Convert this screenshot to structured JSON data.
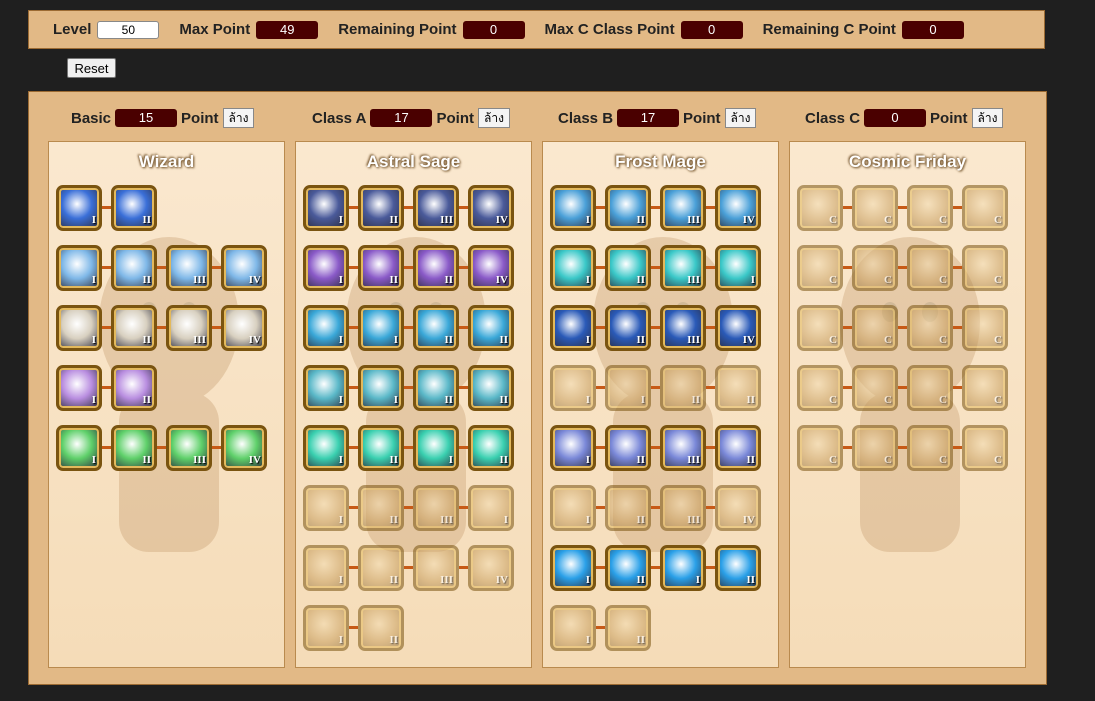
{
  "topbar": {
    "level_label": "Level",
    "level_value": "50",
    "max_point_label": "Max Point",
    "max_point_value": "49",
    "remaining_point_label": "Remaining Point",
    "remaining_point_value": "0",
    "max_c_label": "Max C Class Point",
    "max_c_value": "0",
    "remaining_c_label": "Remaining C Point",
    "remaining_c_value": "0"
  },
  "reset_label": "Reset",
  "point_word": "Point",
  "clear_label": "ล้าง",
  "columns": [
    {
      "key": "basic",
      "label": "Basic",
      "points": "15",
      "title": "Wizard",
      "rows": [
        [
          "I",
          "II"
        ],
        [
          "I",
          "II",
          "III",
          "IV"
        ],
        [
          "I",
          "II",
          "III",
          "IV"
        ],
        [
          "I",
          "II"
        ],
        [
          "I",
          "II",
          "III",
          "IV"
        ]
      ],
      "colors": [
        "#3a6fd8",
        "#7fb8e8",
        "#d8d0c0",
        "#b98ee0",
        "#5fd06a"
      ],
      "faded_rows": [
        false,
        false,
        false,
        false,
        false
      ]
    },
    {
      "key": "class_a",
      "label": "Class A",
      "points": "17",
      "title": "Astral Sage",
      "rows": [
        [
          "I",
          "II",
          "III",
          "IV"
        ],
        [
          "I",
          "II",
          "II",
          "IV"
        ],
        [
          "I",
          "I",
          "II",
          "II"
        ],
        [
          "I",
          "I",
          "II",
          "II"
        ],
        [
          "I",
          "II",
          "I",
          "II"
        ],
        [
          "I",
          "II",
          "III",
          "I"
        ],
        [
          "I",
          "II",
          "III",
          "IV"
        ],
        [
          "I",
          "II"
        ]
      ],
      "colors": [
        "#4a5a9a",
        "#8a5ac8",
        "#3aa8d8",
        "#5ab8c8",
        "#3ad0b0",
        "#c9a060",
        "#c9a060",
        "#c9a060"
      ],
      "faded_rows": [
        false,
        false,
        false,
        false,
        false,
        true,
        true,
        true
      ]
    },
    {
      "key": "class_b",
      "label": "Class B",
      "points": "17",
      "title": "Frost Mage",
      "rows": [
        [
          "I",
          "II",
          "III",
          "IV"
        ],
        [
          "I",
          "II",
          "III",
          "I"
        ],
        [
          "I",
          "II",
          "III",
          "IV"
        ],
        [
          "I",
          "I",
          "II",
          "II"
        ],
        [
          "I",
          "II",
          "III",
          "II"
        ],
        [
          "I",
          "II",
          "III",
          "IV"
        ],
        [
          "I",
          "II",
          "I",
          "II"
        ],
        [
          "I",
          "II"
        ]
      ],
      "colors": [
        "#4aa0d8",
        "#3ac8c8",
        "#2a5ab8",
        "#c9a060",
        "#7a88d8",
        "#c9a060",
        "#2aa0e8",
        "#c9a060"
      ],
      "faded_rows": [
        false,
        false,
        false,
        true,
        false,
        true,
        false,
        true
      ]
    },
    {
      "key": "class_c",
      "label": "Class C",
      "points": "0",
      "title": "Cosmic Friday",
      "rows": [
        [
          "C",
          "C",
          "C",
          "C"
        ],
        [
          "C",
          "C",
          "C",
          "C"
        ],
        [
          "C",
          "C",
          "C",
          "C"
        ],
        [
          "C",
          "C",
          "C",
          "C"
        ],
        [
          "C",
          "C",
          "C",
          "C"
        ]
      ],
      "colors": [
        "#c9a060",
        "#c9a060",
        "#c9a060",
        "#c9a060",
        "#c9a060"
      ],
      "faded_rows": [
        true,
        true,
        true,
        true,
        true
      ]
    }
  ]
}
